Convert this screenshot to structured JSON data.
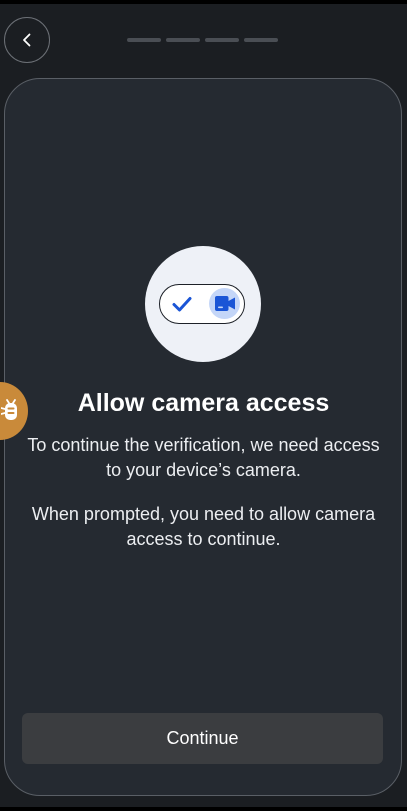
{
  "header": {
    "back_icon": "chevron-left-icon",
    "progress_steps": 4
  },
  "permission": {
    "illustration_icons": [
      "check-icon",
      "video-camera-icon"
    ],
    "title": "Allow camera access",
    "description": "To continue the verification, we need access to your device’s camera.",
    "instruction": "When prompted, you need to allow camera access to continue."
  },
  "actions": {
    "continue_label": "Continue"
  },
  "debug": {
    "icon": "bug-icon"
  },
  "colors": {
    "background": "#1b1e22",
    "card": "#252a31",
    "accent": "#1a55d6",
    "button": "#3b3d40",
    "debug_fab": "#c98a3a"
  }
}
